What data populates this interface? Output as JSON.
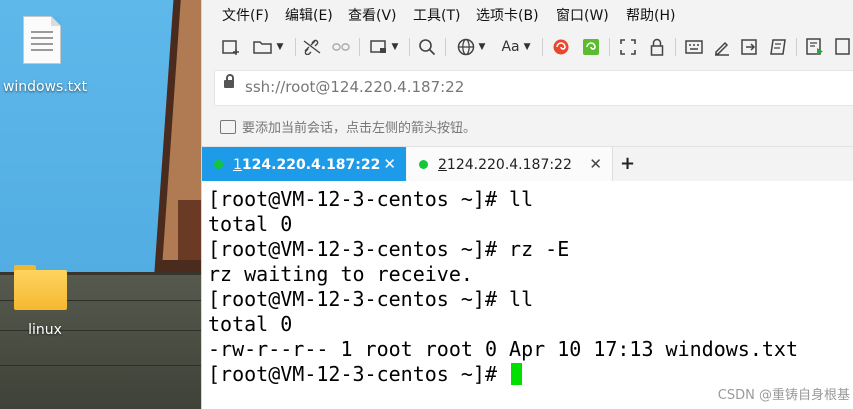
{
  "desktop": {
    "icons": [
      {
        "label": "windows.txt",
        "kind": "text-file"
      },
      {
        "label": "linux",
        "kind": "folder"
      }
    ]
  },
  "app": {
    "menu": [
      "文件(F)",
      "编辑(E)",
      "查看(V)",
      "工具(T)",
      "选项卡(B)",
      "窗口(W)",
      "帮助(H)"
    ],
    "toolbar_icons": [
      "new-session-icon",
      "open-folder-icon",
      "disconnect-icon",
      "reconnect-icon",
      "layout-icon",
      "search-icon",
      "globe-icon",
      "font-icon",
      "xshell-icon",
      "xftp-icon",
      "fullscreen-icon",
      "lock-icon",
      "keyboard-icon",
      "compose-icon",
      "send-icon",
      "script-icon",
      "record-icon"
    ],
    "address": {
      "value": "ssh://root@124.220.4.187:22"
    },
    "hint": "要添加当前会话，点击左侧的箭头按钮。",
    "tabs": [
      {
        "num": "1",
        "title": " 124.220.4.187:22",
        "active": true
      },
      {
        "num": "2",
        "title": " 124.220.4.187:22",
        "active": false
      }
    ],
    "terminal": {
      "lines": [
        "[root@VM-12-3-centos ~]# ll",
        "total 0",
        "[root@VM-12-3-centos ~]# rz -E",
        "rz waiting to receive.",
        "[root@VM-12-3-centos ~]# ll",
        "total 0",
        "-rw-r--r-- 1 root root 0 Apr 10 17:13 windows.txt",
        "[root@VM-12-3-centos ~]# "
      ]
    },
    "watermark": "CSDN @重铸自身根基"
  },
  "colors": {
    "active_tab": "#1e9be8",
    "status_dot": "#12c83a",
    "cursor": "#00e000"
  }
}
